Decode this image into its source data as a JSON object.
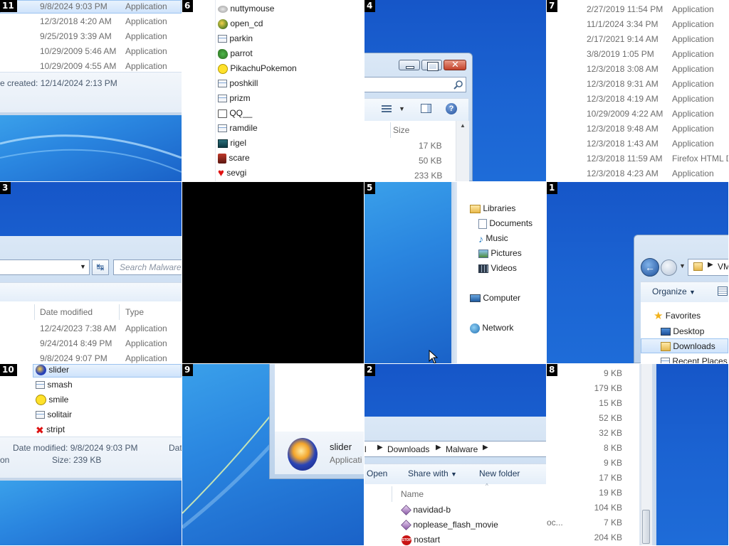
{
  "tiles": {
    "t11": {
      "num": "11",
      "rows": [
        {
          "date": "9/8/2024 9:03 PM",
          "type": "Application"
        },
        {
          "date": "12/3/2018 4:20 AM",
          "type": "Application"
        },
        {
          "date": "9/25/2019 3:39 AM",
          "type": "Application"
        },
        {
          "date": "10/29/2009 5:46 AM",
          "type": "Application"
        },
        {
          "date": "10/29/2009 4:55 AM",
          "type": "Application"
        }
      ],
      "date_created": "e created:  12/14/2024 2:13 PM"
    },
    "t6": {
      "num": "6",
      "files": [
        "nuttymouse",
        "open_cd",
        "parkin",
        "parrot",
        "PikachuPokemon",
        "poshkill",
        "prizm",
        "QQ__",
        "ramdile",
        "rigel",
        "scare",
        "sevgi"
      ]
    },
    "t4": {
      "num": "4",
      "size_header": "Size",
      "sizes": [
        "17 KB",
        "50 KB",
        "233 KB"
      ]
    },
    "t7": {
      "num": "7",
      "rows": [
        {
          "date": "2/27/2019 11:54 PM",
          "type": "Application"
        },
        {
          "date": "11/1/2024 3:34 PM",
          "type": "Application"
        },
        {
          "date": "2/17/2021 9:14 AM",
          "type": "Application"
        },
        {
          "date": "3/8/2019 1:05 PM",
          "type": "Application"
        },
        {
          "date": "12/3/2018 3:08 AM",
          "type": "Application"
        },
        {
          "date": "12/3/2018 9:31 AM",
          "type": "Application"
        },
        {
          "date": "12/3/2018 4:19 AM",
          "type": "Application"
        },
        {
          "date": "10/29/2009 4:22 AM",
          "type": "Application"
        },
        {
          "date": "12/3/2018 9:48 AM",
          "type": "Application"
        },
        {
          "date": "12/3/2018 1:43 AM",
          "type": "Application"
        },
        {
          "date": "12/3/2018 11:59 AM",
          "type": "Firefox HTML D"
        },
        {
          "date": "12/3/2018 4:23 AM",
          "type": "Application"
        }
      ]
    },
    "t3": {
      "num": "3",
      "search_placeholder": "Search Malware",
      "col_date": "Date modified",
      "col_type": "Type",
      "rows": [
        {
          "date": "12/24/2023 7:38 AM",
          "type": "Application"
        },
        {
          "date": "9/24/2014 8:49 PM",
          "type": "Application"
        },
        {
          "date": "9/8/2024 9:07 PM",
          "type": "Application"
        }
      ]
    },
    "t5": {
      "num": "5",
      "libraries": "Libraries",
      "lib_items": [
        "Documents",
        "Music",
        "Pictures",
        "Videos"
      ],
      "computer": "Computer",
      "network": "Network"
    },
    "t1": {
      "num": "1",
      "crumb": "VM",
      "organize": "Organize",
      "favorites": "Favorites",
      "fav_items": [
        "Desktop",
        "Downloads",
        "Recent Places"
      ]
    },
    "t10": {
      "num": "10",
      "files": [
        "slider",
        "smash",
        "smile",
        "solitair",
        "stript"
      ],
      "date_modified": "Date modified:  9/8/2024 9:03 PM",
      "date_trunc": "Dat",
      "left_trunc": "on",
      "size": "Size:  239 KB"
    },
    "t9": {
      "num": "9",
      "name": "slider",
      "type": "Applicati"
    },
    "t2": {
      "num": "2",
      "crumbs": [
        "l",
        "Downloads",
        "Malware"
      ],
      "open": "Open",
      "share": "Share with",
      "newfolder": "New folder",
      "col_name": "Name",
      "files": [
        "navidad-b",
        "noplease_flash_movie",
        "nostart"
      ]
    },
    "t8": {
      "num": "8",
      "sizes": [
        "9 KB",
        "179 KB",
        "15 KB",
        "52 KB",
        "32 KB",
        "8 KB",
        "9 KB",
        "17 KB",
        "19 KB",
        "104 KB",
        "7 KB",
        "204 KB"
      ],
      "left_trunc": "oc..."
    }
  }
}
